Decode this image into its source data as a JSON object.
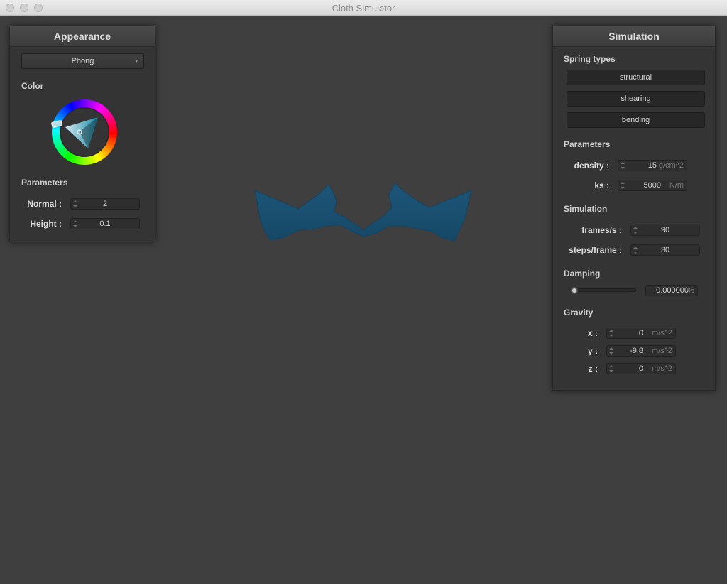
{
  "window": {
    "title": "Cloth Simulator"
  },
  "appearance": {
    "title": "Appearance",
    "shader": "Phong",
    "color_label": "Color",
    "parameters_label": "Parameters",
    "normal_label": "Normal :",
    "normal_value": "2",
    "height_label": "Height :",
    "height_value": "0.1",
    "cloth_color": "#1e5a80"
  },
  "simulation": {
    "title": "Simulation",
    "spring_types_label": "Spring types",
    "spring_types": [
      "structural",
      "shearing",
      "bending"
    ],
    "parameters_label": "Parameters",
    "density_label": "density :",
    "density_value": "15",
    "density_unit": "g/cm^2",
    "ks_label": "ks :",
    "ks_value": "5000",
    "ks_unit": "N/m",
    "sim_label": "Simulation",
    "fps_label": "frames/s :",
    "fps_value": "90",
    "steps_label": "steps/frame :",
    "steps_value": "30",
    "damping_label": "Damping",
    "damping_value": "0.000000",
    "damping_unit": "%",
    "damping_level": 0,
    "gravity_label": "Gravity",
    "gx_label": "x :",
    "gx_value": "0",
    "gy_label": "y :",
    "gy_value": "-9.8",
    "gz_label": "z :",
    "gz_value": "0",
    "gravity_unit": "m/s^2"
  }
}
